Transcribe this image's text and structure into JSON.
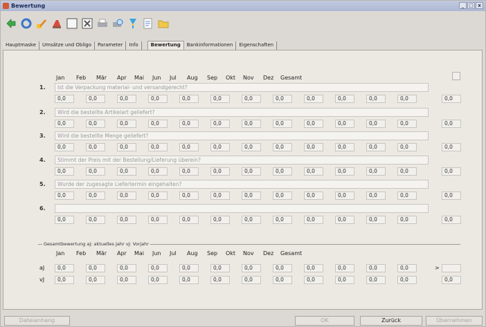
{
  "window": {
    "title": "Bewertung",
    "buttons": [
      "_",
      "□",
      "x"
    ]
  },
  "toolbar": {
    "icons": [
      "back-icon",
      "refresh-icon",
      "edit-icon",
      "delete-icon",
      "blank-icon",
      "table-icon",
      "print-icon",
      "print-preview-icon",
      "filter-icon",
      "document-icon",
      "folder-icon"
    ]
  },
  "tabs": [
    "Hauptmaske",
    "Umsätze und Obligo",
    "Parameter",
    "Info",
    "Bewertung",
    "Bankinformationen",
    "Eigenschaften"
  ],
  "active_tab": "Bewertung",
  "months": [
    "Jan",
    "Feb",
    "Mär",
    "Apr",
    "Mai",
    "Jun",
    "Jul",
    "Aug",
    "Sep",
    "Okt",
    "Nov",
    "Dez",
    "Gesamt"
  ],
  "questions": [
    {
      "num": "1.",
      "text": "Ist die Verpackung material- und versandgerecht?"
    },
    {
      "num": "2.",
      "text": "Wird die bestellte Artikelart geliefert?"
    },
    {
      "num": "3.",
      "text": "Wird die bestellte Menge geliefert?"
    },
    {
      "num": "4.",
      "text": "Stimmt der Preis mit der Bestellung/Lieferung überein?"
    },
    {
      "num": "5.",
      "text": "Wurde der zugesagte Liefertermin eingehalten?"
    },
    {
      "num": "6.",
      "text": ""
    }
  ],
  "value": "0,0",
  "summary": {
    "title": "Gesamtbewertung  aJ: aktuelles Jahr  vJ: Vorjahr",
    "rows": [
      "aJ",
      "vJ"
    ],
    "arrow": ">"
  },
  "buttons": {
    "dateianhang": "Dateianhang",
    "ok": "OK",
    "zurueck": "Zurück",
    "uebernehmen": "Übernehmen"
  }
}
